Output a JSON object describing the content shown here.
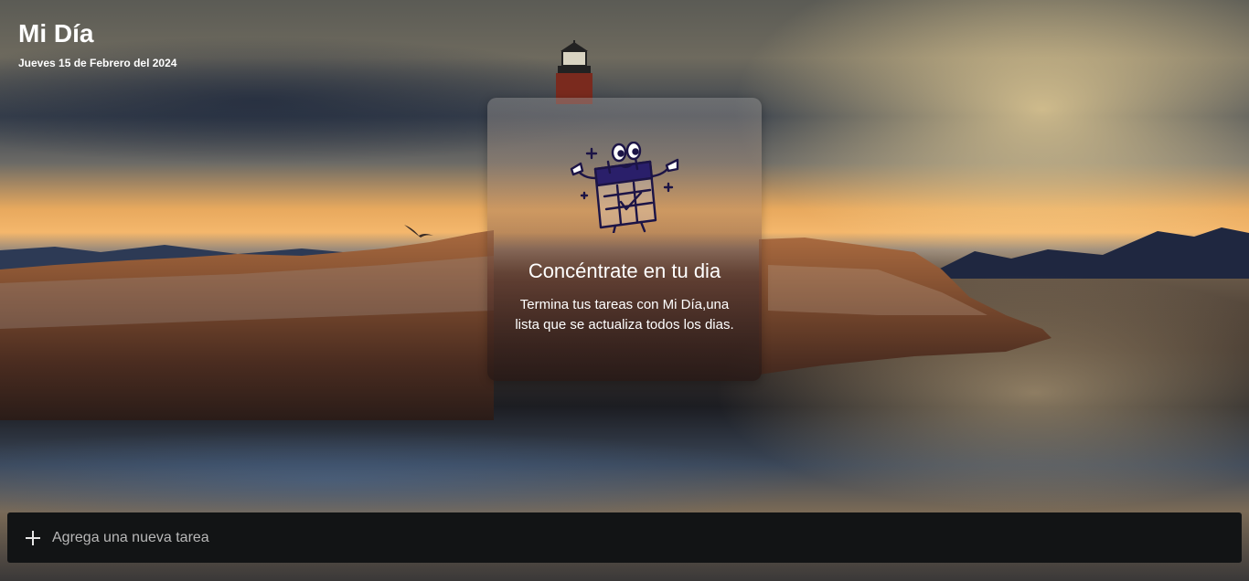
{
  "header": {
    "title": "Mi Día",
    "date": "Jueves 15 de Febrero del 2024"
  },
  "empty_state": {
    "illustration_icon": "calendar-mascot-icon",
    "title": "Concéntrate en tu dia",
    "text": "Termina tus tareas con Mi Día,una lista que se actualiza todos los dias."
  },
  "new_task": {
    "icon": "plus-icon",
    "placeholder": "Agrega una nueva tarea",
    "value": ""
  }
}
